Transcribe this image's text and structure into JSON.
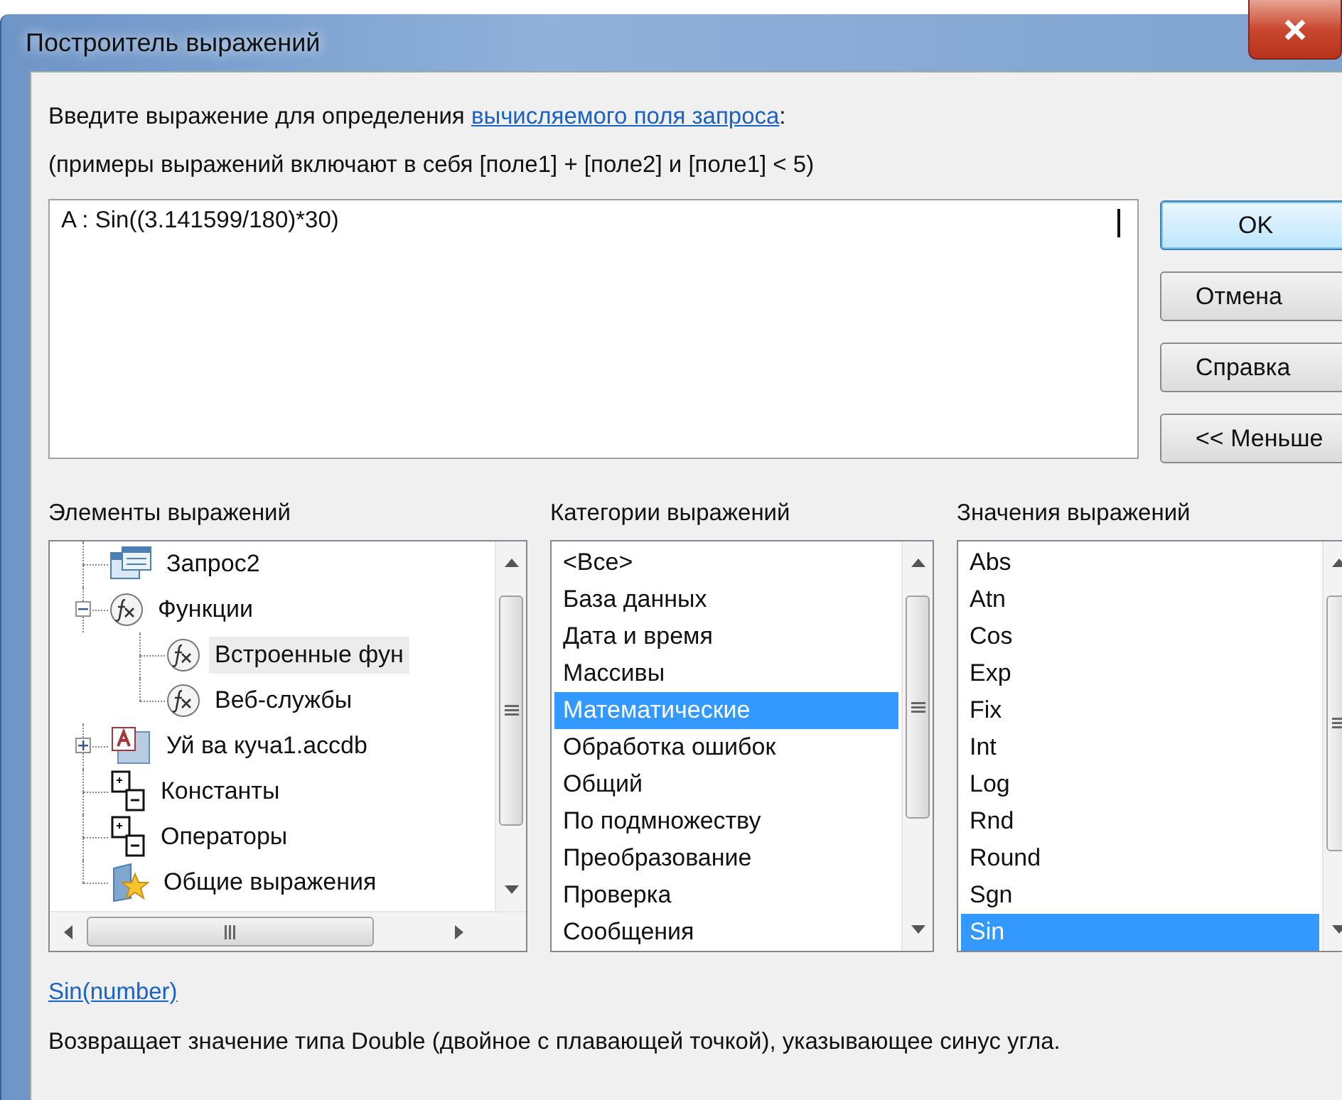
{
  "window": {
    "title": "Построитель выражений"
  },
  "prompt": {
    "text": "Введите выражение для определения ",
    "link": "вычисляемого поля запроса",
    "tail": ":"
  },
  "example": "(примеры выражений включают в себя [поле1] + [поле2] и [поле1] < 5)",
  "expression": "A : Sin((3.141599/180)*30)",
  "buttons": [
    {
      "label": "OK",
      "default": true
    },
    {
      "label": "Отмена",
      "default": false
    },
    {
      "label": "Справка",
      "default": false
    },
    {
      "label": "<< Меньше",
      "default": false
    }
  ],
  "elements": {
    "title": "Элементы выражений",
    "items": [
      {
        "label": "Запрос2",
        "kind": "query",
        "selected": false
      },
      {
        "label": "Функции",
        "kind": "function",
        "selected": false,
        "expanded": true,
        "children": [
          {
            "label": "Встроенные фун",
            "kind": "function",
            "selected": true
          },
          {
            "label": "Веб-службы",
            "kind": "function",
            "selected": false
          }
        ]
      },
      {
        "label": "Уй ва куча1.accdb",
        "kind": "database",
        "selected": false,
        "expanded": false
      },
      {
        "label": "Константы",
        "kind": "constants",
        "selected": false
      },
      {
        "label": "Операторы",
        "kind": "constants",
        "selected": false
      },
      {
        "label": "Общие выражения",
        "kind": "common",
        "selected": false
      }
    ]
  },
  "categories": {
    "title": "Категории выражений",
    "items": [
      {
        "label": "<Все>",
        "selected": false
      },
      {
        "label": "База данных",
        "selected": false
      },
      {
        "label": "Дата и время",
        "selected": false
      },
      {
        "label": "Массивы",
        "selected": false
      },
      {
        "label": "Математические",
        "selected": true
      },
      {
        "label": "Обработка ошибок",
        "selected": false
      },
      {
        "label": "Общий",
        "selected": false
      },
      {
        "label": "По подмножеству",
        "selected": false
      },
      {
        "label": "Преобразование",
        "selected": false
      },
      {
        "label": "Проверка",
        "selected": false
      },
      {
        "label": "Сообщения",
        "selected": false
      }
    ]
  },
  "values": {
    "title": "Значения выражений",
    "items": [
      {
        "label": "Abs",
        "selected": false
      },
      {
        "label": "Atn",
        "selected": false
      },
      {
        "label": "Cos",
        "selected": false
      },
      {
        "label": "Exp",
        "selected": false
      },
      {
        "label": "Fix",
        "selected": false
      },
      {
        "label": "Int",
        "selected": false
      },
      {
        "label": "Log",
        "selected": false
      },
      {
        "label": "Rnd",
        "selected": false
      },
      {
        "label": "Round",
        "selected": false
      },
      {
        "label": "Sgn",
        "selected": false
      },
      {
        "label": "Sin",
        "selected": true
      }
    ]
  },
  "help": {
    "link": "Sin(number)",
    "description": "Возвращает значение типа Double (двойное с плавающей точкой), указывающее синус угла."
  }
}
